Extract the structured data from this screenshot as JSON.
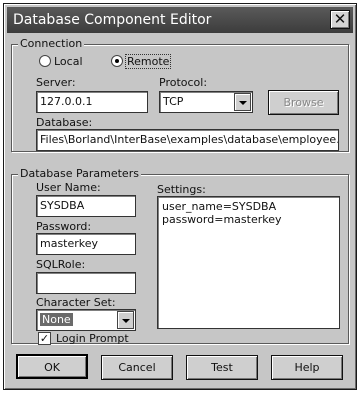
{
  "window": {
    "title": "Database Component Editor",
    "close_glyph": "✕"
  },
  "connection": {
    "legend": "Connection",
    "local_label": "Local",
    "remote_label": "Remote",
    "selected": "remote",
    "server_label": "Server:",
    "server_value": "127.0.0.1",
    "protocol_label": "Protocol:",
    "protocol_value": "TCP",
    "browse_label": "Browse",
    "database_label": "Database:",
    "database_value": "Files\\Borland\\InterBase\\examples\\database\\employee.gdb"
  },
  "params": {
    "legend": "Database Parameters",
    "username_label": "User Name:",
    "username_value": "SYSDBA",
    "password_label": "Password:",
    "password_value": "masterkey",
    "sqlrole_label": "SQLRole:",
    "sqlrole_value": "",
    "charset_label": "Character Set:",
    "charset_value": "None",
    "login_prompt_label": "Login Prompt",
    "login_prompt_checked": true,
    "settings_label": "Settings:",
    "settings_lines": [
      "user_name=SYSDBA",
      "password=masterkey"
    ]
  },
  "buttons": {
    "ok": "OK",
    "cancel": "Cancel",
    "test": "Test",
    "help": "Help"
  }
}
